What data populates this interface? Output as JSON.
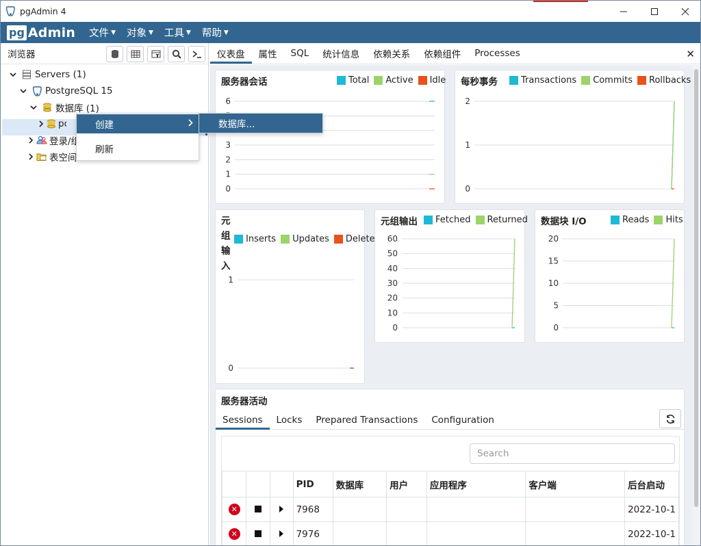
{
  "window": {
    "title": "pgAdmin 4"
  },
  "menubar": {
    "logo_pg": "pg",
    "logo_admin": "Admin",
    "items": [
      "文件",
      "对象",
      "工具",
      "帮助"
    ]
  },
  "browser": {
    "label": "浏览器",
    "tree": {
      "servers": "Servers (1)",
      "postgres": "PostgreSQL 15",
      "databases": "数据库 (1)",
      "postgres_db": "postgres",
      "login": "登录/组角色",
      "tablespaces": "表空间"
    }
  },
  "context_menu": {
    "create": "创建",
    "refresh": "刷新",
    "submenu_database": "数据库..."
  },
  "tabs": [
    "仪表盘",
    "属性",
    "SQL",
    "统计信息",
    "依赖关系",
    "依赖组件",
    "Processes"
  ],
  "colors": {
    "total": "#1fb9d6",
    "active": "#9bd46a",
    "idle": "#e8521d",
    "accent": "#326690"
  },
  "charts": {
    "sessions": {
      "title": "服务器会话",
      "legend": [
        "Total",
        "Active",
        "Idle"
      ]
    },
    "tps": {
      "title": "每秒事务",
      "legend": [
        "Transactions",
        "Commits",
        "Rollbacks"
      ]
    },
    "tuples_in": {
      "title": "元组输入",
      "legend": [
        "Inserts",
        "Updates",
        "Deletes"
      ]
    },
    "tuples_out": {
      "title": "元组输出",
      "legend": [
        "Fetched",
        "Returned"
      ]
    },
    "block_io": {
      "title": "数据块 I/O",
      "legend": [
        "Reads",
        "Hits"
      ]
    }
  },
  "chart_data": [
    {
      "type": "line",
      "title": "服务器会话",
      "yticks": [
        "0",
        "1",
        "2",
        "3",
        "4",
        "5",
        "6"
      ],
      "ylim": [
        0,
        6
      ],
      "series": [
        {
          "name": "Total",
          "values": [
            6
          ]
        },
        {
          "name": "Active",
          "values": [
            1
          ]
        },
        {
          "name": "Idle",
          "values": [
            0
          ]
        }
      ]
    },
    {
      "type": "line",
      "title": "每秒事务",
      "yticks": [
        "0",
        "1",
        "2"
      ],
      "ylim": [
        0,
        2
      ],
      "series": [
        {
          "name": "Transactions",
          "values": [
            0,
            2
          ]
        },
        {
          "name": "Commits",
          "values": [
            0,
            2
          ]
        },
        {
          "name": "Rollbacks",
          "values": [
            0,
            0
          ]
        }
      ]
    },
    {
      "type": "line",
      "title": "元组输入",
      "yticks": [
        "0",
        "1"
      ],
      "ylim": [
        0,
        1
      ],
      "series": [
        {
          "name": "Inserts",
          "values": [
            0
          ]
        },
        {
          "name": "Updates",
          "values": [
            0
          ]
        },
        {
          "name": "Deletes",
          "values": [
            0
          ]
        }
      ]
    },
    {
      "type": "line",
      "title": "元组输出",
      "yticks": [
        "0",
        "10",
        "20",
        "30",
        "40",
        "50",
        "60"
      ],
      "ylim": [
        0,
        60
      ],
      "series": [
        {
          "name": "Fetched",
          "values": [
            0,
            0
          ]
        },
        {
          "name": "Returned",
          "values": [
            0,
            60
          ]
        }
      ]
    },
    {
      "type": "line",
      "title": "数据块 I/O",
      "yticks": [
        "0",
        "5",
        "10",
        "15",
        "20"
      ],
      "ylim": [
        0,
        20
      ],
      "series": [
        {
          "name": "Reads",
          "values": [
            0,
            0
          ]
        },
        {
          "name": "Hits",
          "values": [
            0,
            20
          ]
        }
      ]
    }
  ],
  "activity": {
    "title": "服务器活动",
    "tabs": [
      "Sessions",
      "Locks",
      "Prepared Transactions",
      "Configuration"
    ],
    "search_placeholder": "Search",
    "columns": [
      "PID",
      "数据库",
      "用户",
      "应用程序",
      "客户端",
      "后台启动"
    ],
    "rows": [
      {
        "pid": "7968",
        "db": "",
        "user": "",
        "app": "",
        "client": "",
        "backend_start": "2022-10-1"
      },
      {
        "pid": "7976",
        "db": "",
        "user": "",
        "app": "",
        "client": "",
        "backend_start": "2022-10-1"
      }
    ]
  }
}
